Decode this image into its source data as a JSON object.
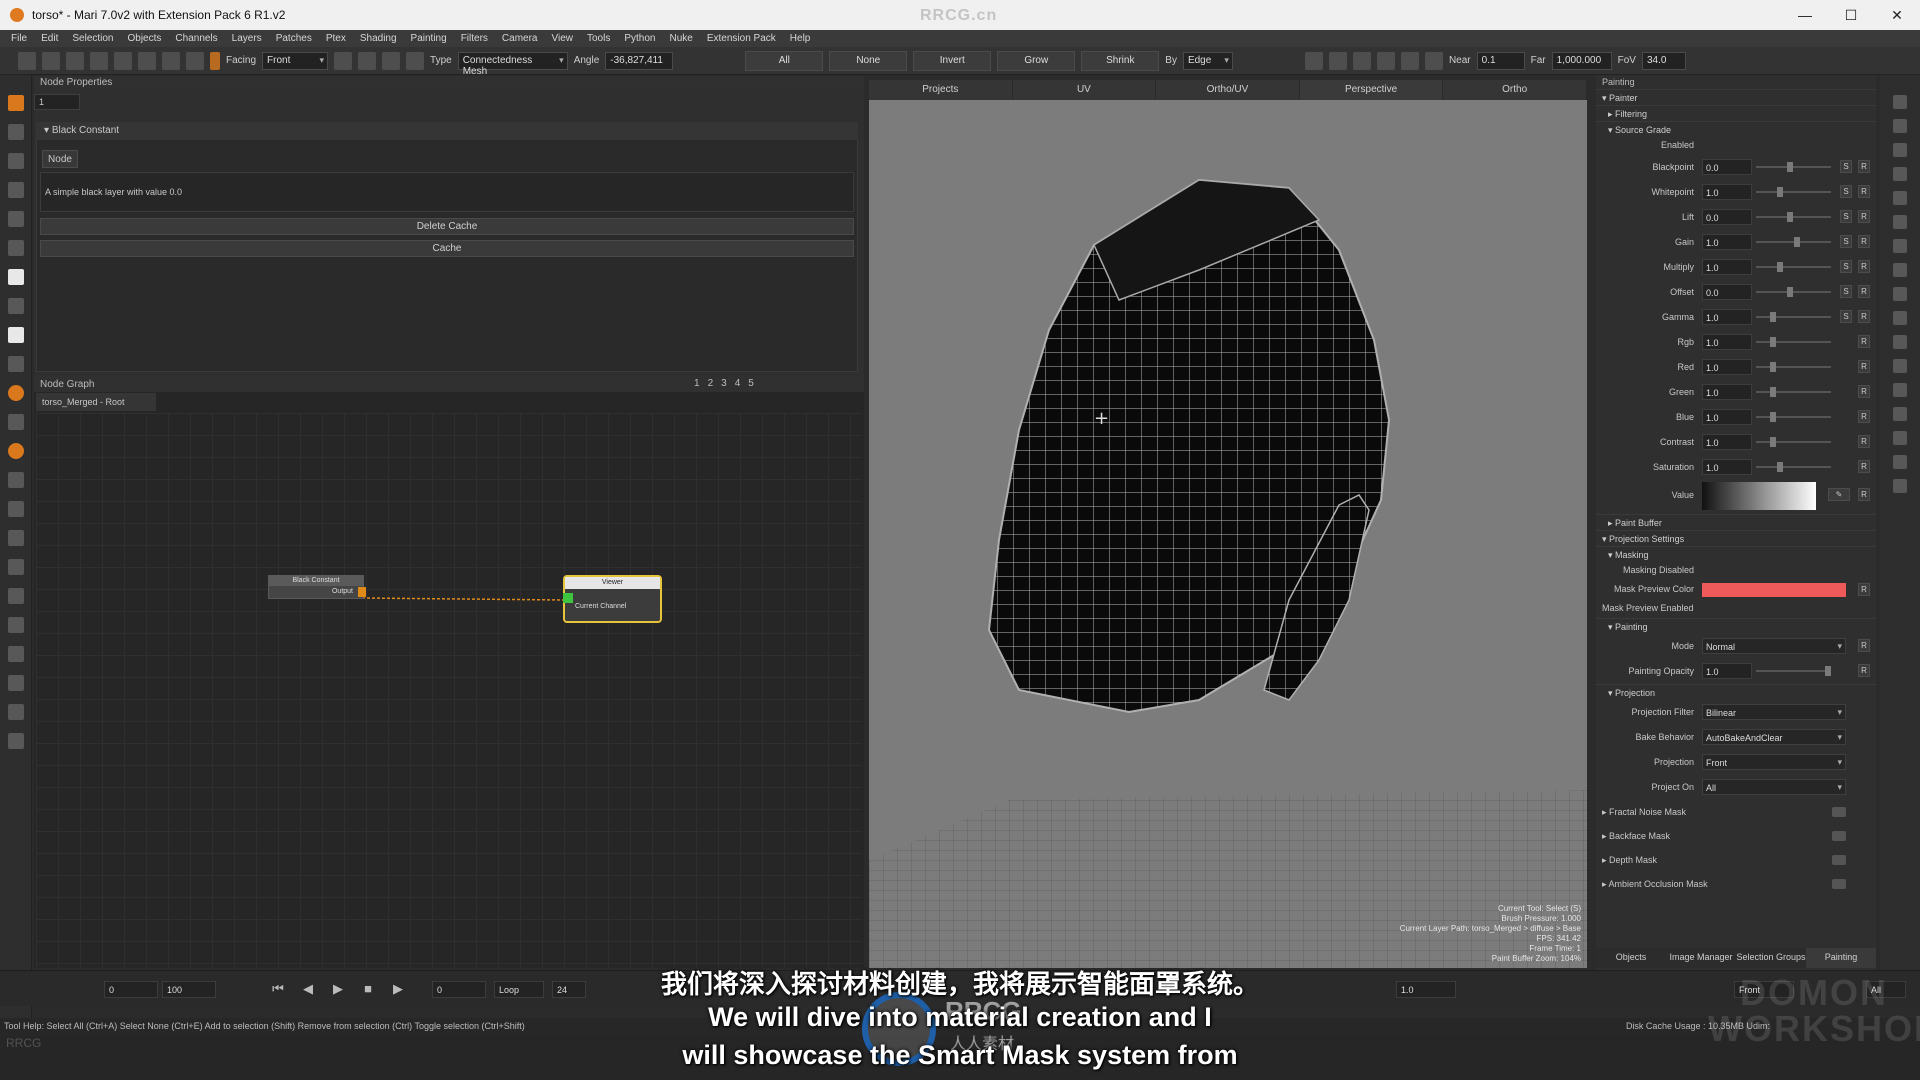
{
  "window": {
    "title": "torso* - Mari 7.0v2 with Extension Pack 6 R1.v2",
    "watermark": "RRCG.cn",
    "controls": [
      "—",
      "☐",
      "✕"
    ]
  },
  "menu": [
    "File",
    "Edit",
    "Selection",
    "Objects",
    "Channels",
    "Layers",
    "Patches",
    "Ptex",
    "Shading",
    "Painting",
    "Filters",
    "Camera",
    "View",
    "Tools",
    "Python",
    "Nuke",
    "Extension Pack",
    "Help"
  ],
  "toolbar": {
    "facing_label": "Facing",
    "facing_value": "Front",
    "type_label": "Type",
    "type_value": "Connectedness Mesh",
    "angle_label": "Angle",
    "angle_value": "-36,827,411",
    "buttons": [
      "All",
      "None",
      "Invert",
      "Grow",
      "Shrink"
    ],
    "by_label": "By",
    "by_value": "Edge",
    "near_label": "Near",
    "near_value": "0.1",
    "far_label": "Far",
    "far_value": "1,000.000",
    "fov_label": "FoV",
    "fov_value": "34.0"
  },
  "node_properties": {
    "panel_title": "Node Properties",
    "count": "1",
    "section": "Black Constant",
    "tab": "Node",
    "description": "A simple black layer with value 0.0",
    "delete_cache": "Delete Cache",
    "cache": "Cache"
  },
  "node_graph": {
    "panel_title": "Node Graph",
    "tab": "torso_Merged - Root",
    "pages": [
      "1",
      "2",
      "3",
      "4",
      "5"
    ],
    "node_a": {
      "title": "Black Constant",
      "port": "Output"
    },
    "node_b": {
      "title": "Viewer",
      "port": "Current Channel"
    },
    "accent_color": "#e8c43a",
    "wire_color": "#e08a1a"
  },
  "viewport": {
    "tabs": [
      "Projects",
      "UV",
      "Ortho/UV",
      "Perspective",
      "Ortho"
    ],
    "status_lines": [
      "Current Tool: Select (S)",
      "Brush Pressure: 1.000",
      "Current Layer Path: torso_Merged > diffuse > Base",
      "FPS: 341.42",
      "Frame Time: 1",
      "Paint Buffer Zoom: 104%"
    ]
  },
  "painting_panel": {
    "title": "Painting",
    "painter": "Painter",
    "filtering": "Filtering",
    "source_grade": "Source Grade",
    "enabled_label": "Enabled",
    "grade_rows": [
      {
        "label": "Blackpoint",
        "value": "0.0",
        "s": true,
        "level": 0.45
      },
      {
        "label": "Whitepoint",
        "value": "1.0",
        "s": true,
        "level": 0.3
      },
      {
        "label": "Lift",
        "value": "0.0",
        "s": true,
        "level": 0.45
      },
      {
        "label": "Gain",
        "value": "1.0",
        "s": true,
        "level": 0.55
      },
      {
        "label": "Multiply",
        "value": "1.0",
        "s": true,
        "level": 0.3
      },
      {
        "label": "Offset",
        "value": "0.0",
        "s": true,
        "level": 0.45
      },
      {
        "label": "Gamma",
        "value": "1.0",
        "s": true,
        "level": 0.2
      },
      {
        "label": "Rgb",
        "value": "1.0",
        "s": false,
        "level": 0.2
      },
      {
        "label": "Red",
        "value": "1.0",
        "s": false,
        "level": 0.2
      },
      {
        "label": "Green",
        "value": "1.0",
        "s": false,
        "level": 0.2
      },
      {
        "label": "Blue",
        "value": "1.0",
        "s": false,
        "level": 0.2
      },
      {
        "label": "Contrast",
        "value": "1.0",
        "s": false,
        "level": 0.2
      },
      {
        "label": "Saturation",
        "value": "1.0",
        "s": false,
        "level": 0.3
      }
    ],
    "value_label": "Value",
    "paint_buffer": "Paint Buffer",
    "projection_settings": "Projection Settings",
    "masking": "Masking",
    "masking_disabled": "Masking Disabled",
    "mask_preview_color_label": "Mask Preview Color",
    "mask_preview_color": "#ee5a5a",
    "mask_preview_enabled": "Mask Preview Enabled",
    "painting": "Painting",
    "mode_label": "Mode",
    "mode_value": "Normal",
    "opacity_label": "Painting Opacity",
    "opacity_value": "1.0",
    "projection": "Projection",
    "projection_filter_label": "Projection Filter",
    "projection_filter_value": "Bilinear",
    "bake_behavior_label": "Bake Behavior",
    "bake_behavior_value": "AutoBakeAndClear",
    "projection_label": "Projection",
    "projection_value": "Front",
    "project_on_label": "Project On",
    "project_on_value": "All",
    "masks": [
      "Fractal Noise Mask",
      "Backface Mask",
      "Depth Mask",
      "Ambient Occlusion Mask"
    ],
    "bottom_tabs": [
      "Objects",
      "Image Manager",
      "Selection Groups",
      "Painting"
    ]
  },
  "timeline": {
    "start": "0",
    "end": "100",
    "current": "0",
    "loop": "Loop",
    "fps": "24",
    "r_value": "1.0",
    "view_value": "Front",
    "all_value": "All"
  },
  "status": {
    "tool_help": "Tool Help: Select All (Ctrl+A)    Select None (Ctrl+E)    Add to selection (Shift)    Remove from selection (Ctrl)    Toggle selection (Ctrl+Shift)",
    "disk_cache": "Disk Cache Usage : 10.35MB  Udim:"
  },
  "subtitles": {
    "cn": "我们将深入探讨材料创建，我将展示智能面罩系统。",
    "en1": "We will dive into material creation and I",
    "en2": "will showcase the Smart Mask system from"
  },
  "overlay": {
    "logo_text": "RRCG",
    "logo_sub": "人人素材",
    "brand": "DOMON WORKSHOP"
  }
}
